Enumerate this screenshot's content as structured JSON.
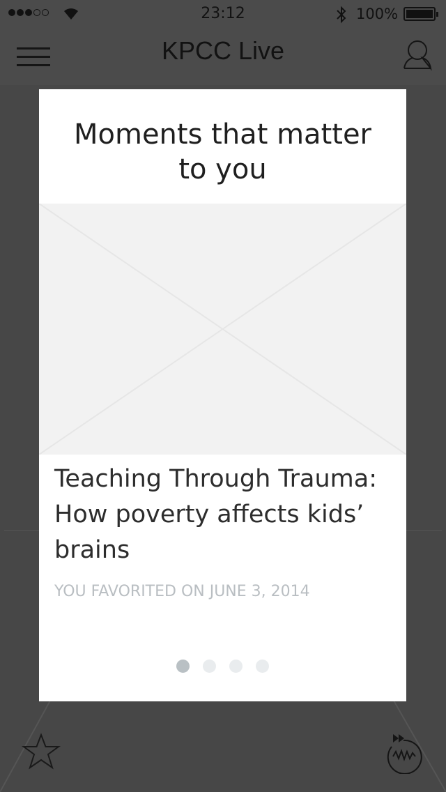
{
  "status_bar": {
    "time": "23:12",
    "battery_percent": "100%",
    "signal_bars_filled": 3,
    "signal_bars_total": 5
  },
  "nav": {
    "title": "KPCC Live",
    "menu_icon": "hamburger-menu-icon",
    "user_icon": "user-profile-icon"
  },
  "modal": {
    "title": "Moments that matter to you",
    "image_placeholder_icon": "image-placeholder-icon",
    "story": {
      "title": "Teaching Through Trauma: How poverty affects kids’ brains",
      "meta": "YOU FAVORITED ON JUNE 3, 2014"
    },
    "pager": {
      "total": 4,
      "active_index": 0
    }
  },
  "toolbar": {
    "favorite_icon": "star-icon",
    "rewind_icon": "rewind-icon"
  },
  "colors": {
    "dim_background": "#474747",
    "card": "#ffffff",
    "placeholder": "#f2f2f2",
    "meta_text": "#b9bec2",
    "pager_active": "#b9c0c4",
    "pager_inactive": "#e9ecee"
  }
}
